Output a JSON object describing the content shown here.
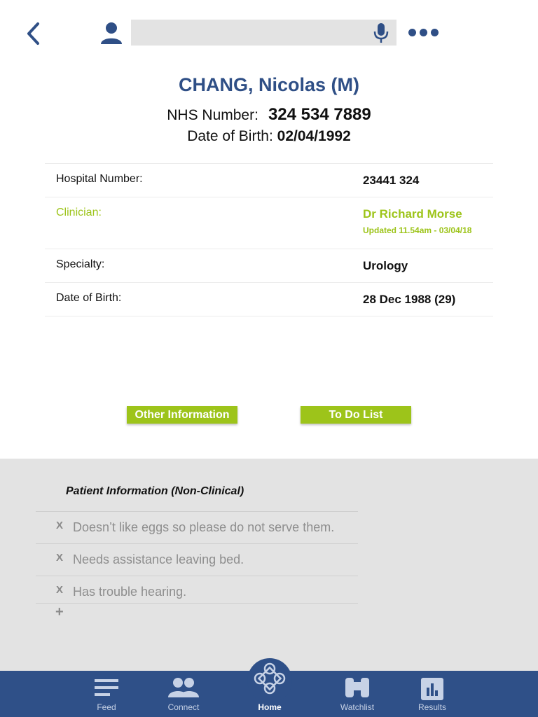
{
  "header": {
    "patient_name": "CHANG, Nicolas (M)",
    "nhs_label": "NHS Number:",
    "nhs_value": "324 534 7889",
    "dob_label": "Date of Birth:",
    "dob_value": "02/04/1992"
  },
  "search": {
    "placeholder": ""
  },
  "details": {
    "hospital_number_label": "Hospital Number:",
    "hospital_number_value": "23441 324",
    "clinician_label": "Clinician:",
    "clinician_value": "Dr Richard Morse",
    "clinician_updated": "Updated 11.54am - 03/04/18",
    "specialty_label": "Specialty:",
    "specialty_value": "Urology",
    "dob_label": "Date of Birth:",
    "dob_value": "28 Dec 1988 (29)"
  },
  "buttons": {
    "other_information": "Other Information",
    "todo_list": "To Do List"
  },
  "patient_info": {
    "title": "Patient Information (Non-Clinical)",
    "remove_symbol": "X",
    "add_symbol": "+",
    "items": [
      "Doesn’t like eggs so please do not serve them.",
      "Needs assistance leaving bed.",
      "Has trouble hearing."
    ]
  },
  "nav": {
    "feed": "Feed",
    "connect": "Connect",
    "home": "Home",
    "watchlist": "Watchlist",
    "results": "Results"
  },
  "colors": {
    "brand_blue": "#2f5088",
    "accent_green": "#9dc41a",
    "panel_grey": "#e3e3e3"
  },
  "icons": {
    "back": "chevron-left-icon",
    "user": "person-icon",
    "mic": "microphone-icon",
    "more": "more-dots-icon",
    "feed": "feed-lines-icon",
    "connect": "people-icon",
    "home": "home-knot-icon",
    "watchlist": "binoculars-icon",
    "results": "bar-chart-icon"
  }
}
